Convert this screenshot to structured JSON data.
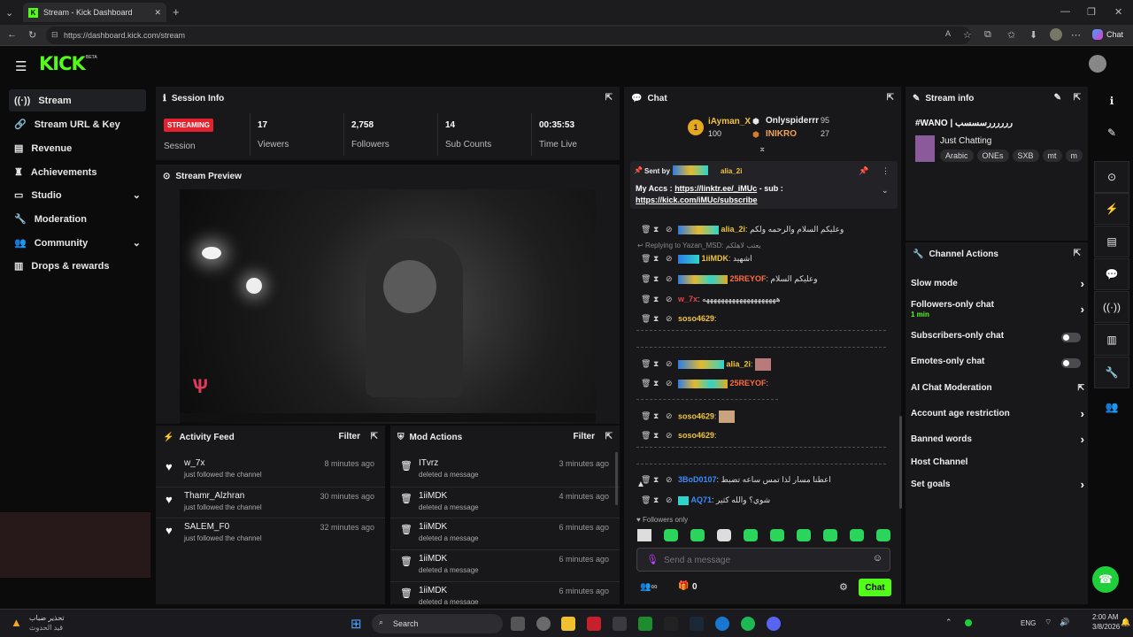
{
  "browser": {
    "tab_title": "Stream - Kick Dashboard",
    "url": "https://dashboard.kick.com/stream",
    "chat_button": "Chat"
  },
  "app": {
    "logo": "KICK",
    "beta": "BETA"
  },
  "sidebar": {
    "items": [
      {
        "label": "Stream",
        "icon": "broadcast-icon"
      },
      {
        "label": "Stream URL & Key",
        "icon": "link-icon"
      },
      {
        "label": "Revenue",
        "icon": "money-icon"
      },
      {
        "label": "Achievements",
        "icon": "trophy-icon"
      },
      {
        "label": "Studio",
        "icon": "studio-icon"
      },
      {
        "label": "Moderation",
        "icon": "wrench-icon"
      },
      {
        "label": "Community",
        "icon": "users-icon"
      },
      {
        "label": "Drops & rewards",
        "icon": "gift-icon"
      }
    ]
  },
  "session": {
    "title": "Session Info",
    "badge": "STREAMING",
    "session_label": "Session",
    "stats": [
      {
        "value": "17",
        "label": "Viewers"
      },
      {
        "value": "2,758",
        "label": "Followers"
      },
      {
        "value": "14",
        "label": "Sub Counts"
      },
      {
        "value": "00:35:53",
        "label": "Time Live"
      }
    ]
  },
  "preview": {
    "title": "Stream Preview"
  },
  "activity": {
    "title": "Activity Feed",
    "filter": "Filter",
    "items": [
      {
        "name": "w_7x",
        "sub": "just followed the channel",
        "time": "8 minutes ago"
      },
      {
        "name": "Thamr_Alzhran",
        "sub": "just followed the channel",
        "time": "30 minutes ago"
      },
      {
        "name": "SALEM_F0",
        "sub": "just followed the channel",
        "time": "32 minutes ago"
      }
    ]
  },
  "modactions": {
    "title": "Mod Actions",
    "filter": "Filter",
    "items": [
      {
        "name": "ITvrz",
        "sub": "deleted a message",
        "time": "3 minutes ago"
      },
      {
        "name": "1iiMDK",
        "sub": "deleted a message",
        "time": "4 minutes ago"
      },
      {
        "name": "1iiMDK",
        "sub": "deleted a message",
        "time": "6 minutes ago"
      },
      {
        "name": "1iiMDK",
        "sub": "deleted a message",
        "time": "6 minutes ago"
      },
      {
        "name": "1iiMDK",
        "sub": "deleted a message",
        "time": "6 minutes ago"
      }
    ]
  },
  "chat": {
    "title": "Chat",
    "leader": [
      {
        "rank": "1",
        "name": "iAyman_X",
        "score": "100"
      },
      {
        "name": "Onlyspiderrr",
        "score": "95"
      },
      {
        "name": "INIKRO",
        "score": "27"
      }
    ],
    "pinned": {
      "sent_by": "Sent by",
      "author": "alia_2i",
      "text1": "My Accs : ",
      "link1": "https://linktr.ee/_iMUc",
      "text2": " - sub :",
      "link2": "https://kick.com/iMUc/subscribe"
    },
    "reply_note": "Replying to Yazan_MSD: يعتب لاهلكم",
    "messages": [
      {
        "user": "alia_2i",
        "color": "#f0c33c",
        "text": "وعليكم السلام والرحمه ولكم"
      },
      {
        "user": "1iiMDK",
        "color": "#f0c33c",
        "text": "اشهيد"
      },
      {
        "user": "25REYOF",
        "color": "#ff6b3d",
        "text": "وعليكم السلام"
      },
      {
        "user": "w_7x",
        "color": "#e84545",
        "text": "ههههههههههههههههههههه"
      },
      {
        "user": "soso4629",
        "color": "#f0c33c",
        "text": ""
      },
      {
        "user": "alia_2i",
        "color": "#f0c33c",
        "text": ""
      },
      {
        "user": "25REYOF",
        "color": "#ff6b3d",
        "text": ""
      },
      {
        "user": "soso4629",
        "color": "#f0c33c",
        "text": ""
      },
      {
        "user": "soso4629",
        "color": "#f0c33c",
        "text": ""
      },
      {
        "user": "3BoD0107",
        "color": "#3b8bff",
        "text": "اعطنا مسار لذا تمس ساعه تضبط"
      },
      {
        "user": "AQ71",
        "color": "#3b8bff",
        "text": "شوي؟ والله كثير"
      }
    ],
    "followers_only": "Followers only",
    "input_placeholder": "Send a message",
    "send": "Chat",
    "count": "0"
  },
  "streaminfo": {
    "title": "Stream info",
    "stream_title": "#WANO | ررررررسسسب",
    "category": "Just Chatting",
    "tags": [
      "Arabic",
      "ONEs",
      "SXB",
      "mt",
      "m"
    ]
  },
  "channelactions": {
    "title": "Channel Actions",
    "rows": [
      {
        "label": "Slow mode"
      },
      {
        "label": "Followers-only chat",
        "sub": "1 min"
      },
      {
        "label": "Subscribers-only chat"
      },
      {
        "label": "Emotes-only chat"
      },
      {
        "label": "AI Chat Moderation"
      },
      {
        "label": "Account age restriction"
      },
      {
        "label": "Banned words"
      },
      {
        "label": "Host Channel"
      },
      {
        "label": "Set goals"
      }
    ]
  },
  "taskbar": {
    "search": "Search",
    "weather": "تحذير ضباب",
    "weather_sub": "قيد الحدوث",
    "lang": "ENG",
    "time": "2:00 AM",
    "date": "3/8/2026"
  },
  "colors": {
    "accent": "#53fc18",
    "streaming": "#e3222d"
  }
}
